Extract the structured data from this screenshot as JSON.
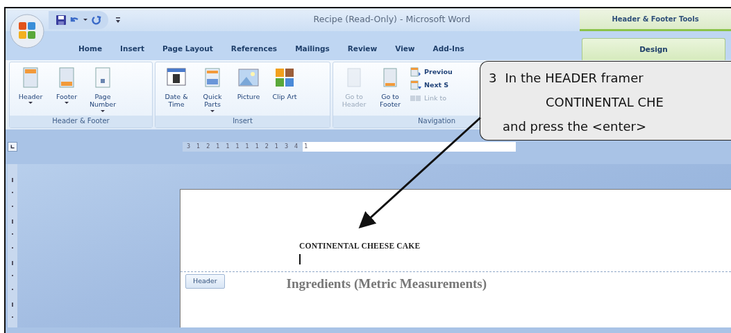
{
  "window": {
    "title": "Recipe (Read-Only) - Microsoft Word",
    "contextual_group": "Header & Footer Tools"
  },
  "tabs": [
    {
      "label": "Home",
      "selected": false
    },
    {
      "label": "Insert",
      "selected": false
    },
    {
      "label": "Page Layout",
      "selected": false
    },
    {
      "label": "References",
      "selected": false
    },
    {
      "label": "Mailings",
      "selected": false
    },
    {
      "label": "Review",
      "selected": false
    },
    {
      "label": "View",
      "selected": false
    },
    {
      "label": "Add-Ins",
      "selected": false
    },
    {
      "label": "Design",
      "selected": true,
      "kind": "contextual"
    }
  ],
  "ribbon_groups": [
    {
      "label": "Header & Footer",
      "buttons": [
        {
          "kind": "large",
          "label": "Header",
          "dropdown": true,
          "disabled": false
        },
        {
          "kind": "large",
          "label": "Footer",
          "dropdown": true,
          "disabled": false
        },
        {
          "kind": "large",
          "label": "Page Number",
          "dropdown": true,
          "disabled": false
        }
      ]
    },
    {
      "label": "Insert",
      "buttons": [
        {
          "kind": "large",
          "label": "Date & Time",
          "dropdown": false,
          "disabled": false
        },
        {
          "kind": "large",
          "label": "Quick Parts",
          "dropdown": true,
          "disabled": false
        },
        {
          "kind": "large",
          "label": "Picture",
          "dropdown": false,
          "disabled": false
        },
        {
          "kind": "large",
          "label": "Clip Art",
          "dropdown": false,
          "disabled": false
        }
      ]
    },
    {
      "label": "Navigation",
      "buttons": [
        {
          "kind": "large",
          "label": "Go to Header",
          "dropdown": false,
          "disabled": true
        },
        {
          "kind": "large",
          "label": "Go to Footer",
          "dropdown": false,
          "disabled": false
        },
        {
          "kind": "small",
          "label": "Previou",
          "disabled": false
        },
        {
          "kind": "small",
          "label": "Next S",
          "disabled": false
        },
        {
          "kind": "small",
          "label": "Link to",
          "disabled": true
        }
      ]
    }
  ],
  "ruler": {
    "numbers": [
      "3",
      "1",
      "2",
      "1",
      "1",
      "1",
      "1",
      "1",
      "2",
      "1",
      "3",
      "4",
      "1"
    ]
  },
  "document": {
    "header_text": "CONTINENTAL CHEESE CAKE",
    "header_tag": "Header",
    "heading": "Ingredients (Metric Measurements)"
  },
  "callout": {
    "step": "3",
    "lines": [
      "In the HEADER framer",
      "CONTINENTAL CHE",
      "and press the <enter>"
    ]
  }
}
